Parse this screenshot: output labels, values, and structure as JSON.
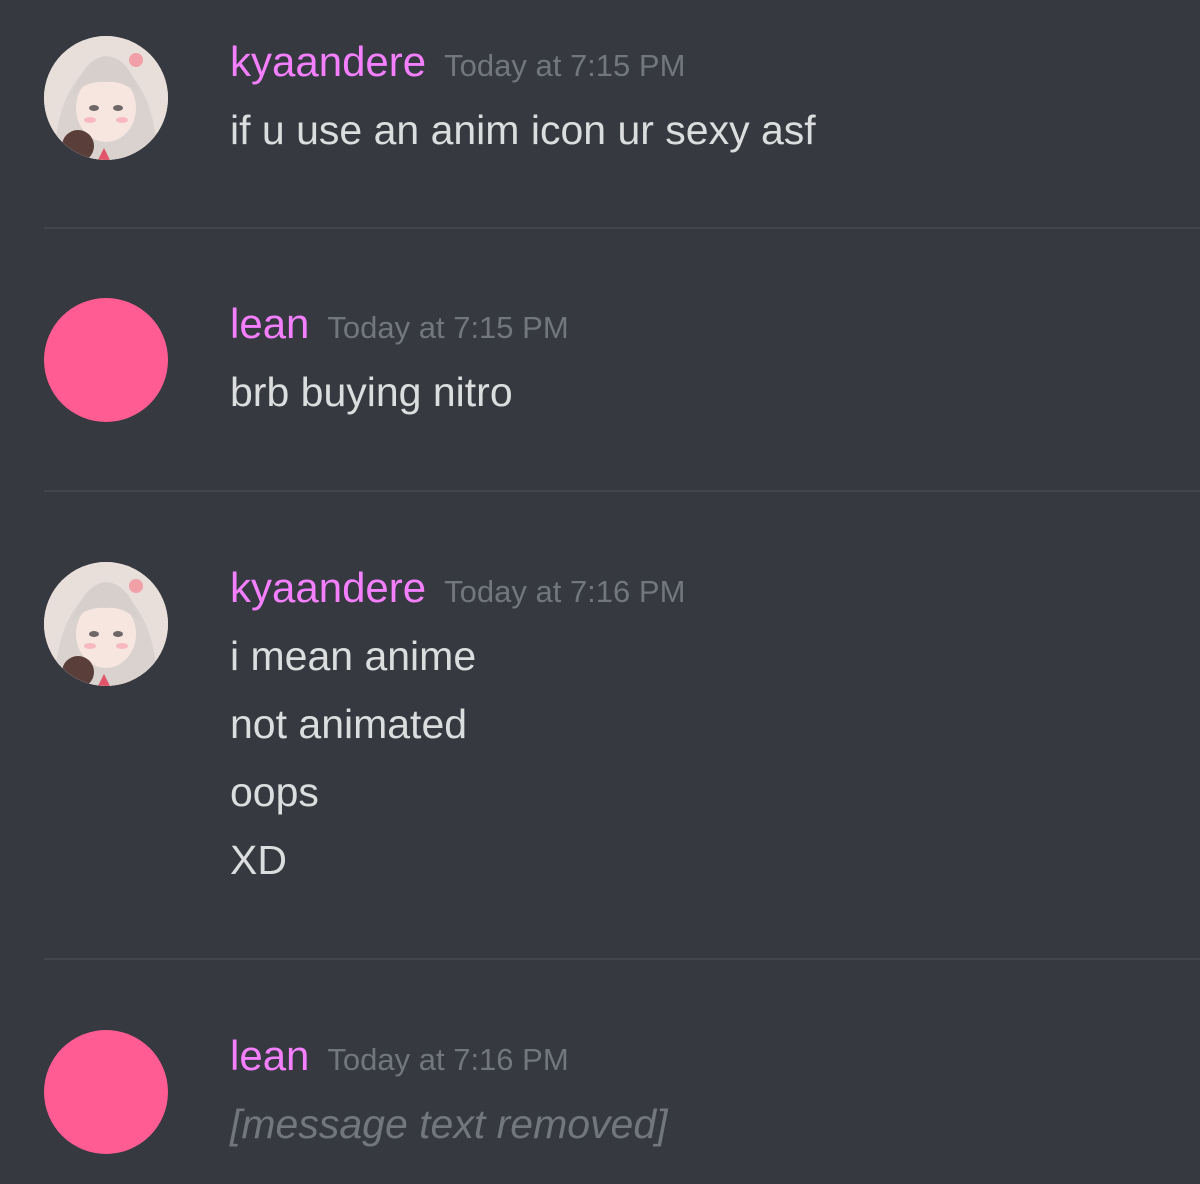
{
  "messages": [
    {
      "username": "kyaandere",
      "timestamp": "Today at 7:15 PM",
      "avatar_icon": "anime-girl-avatar-icon",
      "lines": [
        "if u use an anim icon ur sexy asf"
      ]
    },
    {
      "username": "lean",
      "timestamp": "Today at 7:15 PM",
      "avatar_icon": "pink-circle-avatar-icon",
      "lines": [
        "brb buying nitro"
      ]
    },
    {
      "username": "kyaandere",
      "timestamp": "Today at 7:16 PM",
      "avatar_icon": "anime-girl-avatar-icon",
      "lines": [
        "i mean anime",
        "not animated",
        "oops",
        "XD"
      ]
    },
    {
      "username": "lean",
      "timestamp": "Today at 7:16 PM",
      "avatar_icon": "pink-circle-avatar-icon",
      "lines": [
        "[message text removed]"
      ]
    }
  ],
  "colors": {
    "background": "#36393f",
    "username": "#f47fff",
    "timestamp": "#72767d",
    "message_text": "#dcddde",
    "divider": "#42454a",
    "pink_avatar": "#ff5c93"
  }
}
